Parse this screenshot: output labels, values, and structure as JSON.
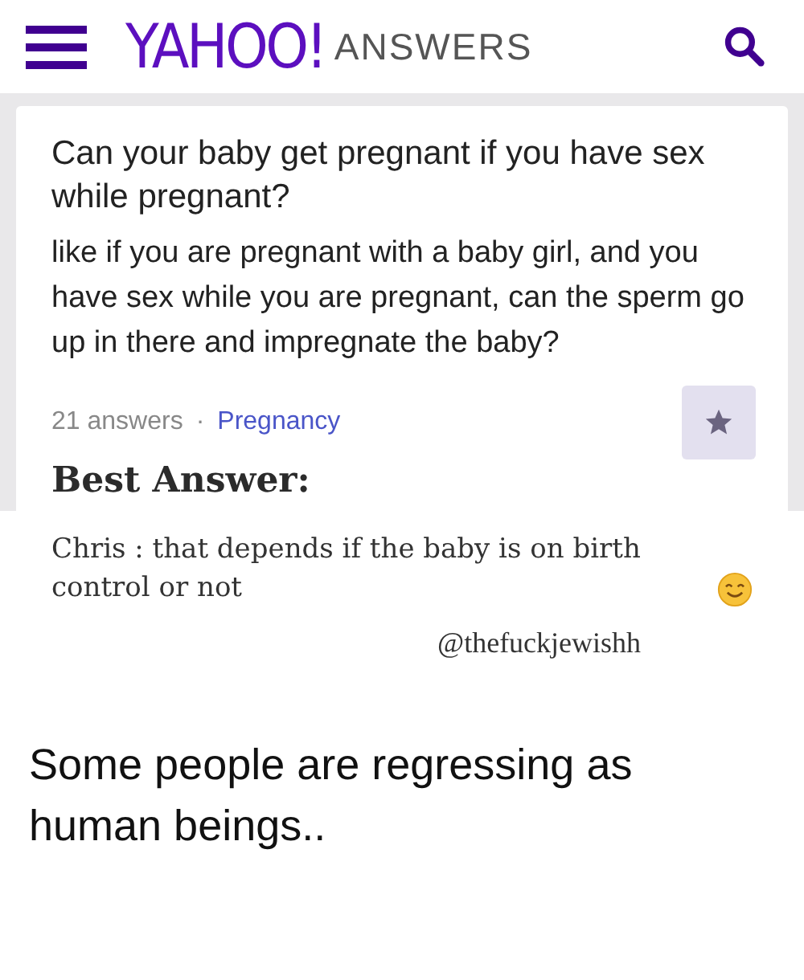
{
  "header": {
    "logo": "YAHOO!",
    "section": "ANSWERS"
  },
  "question": {
    "title": "Can your baby get pregnant if you have sex while pregnant?",
    "body": "like if you are pregnant with a baby girl, and you have sex while you are pregnant, can the sperm go up in there and impregnate the baby?",
    "answers_count": "21 answers",
    "separator": "·",
    "category": "Pregnancy",
    "starred": false
  },
  "best_answer": {
    "heading": "Best Answer:",
    "text": "Chris : that depends if the baby is on birth control or not",
    "handle": "@thefuckjewishh"
  },
  "caption": "Some people are regressing as human beings.."
}
